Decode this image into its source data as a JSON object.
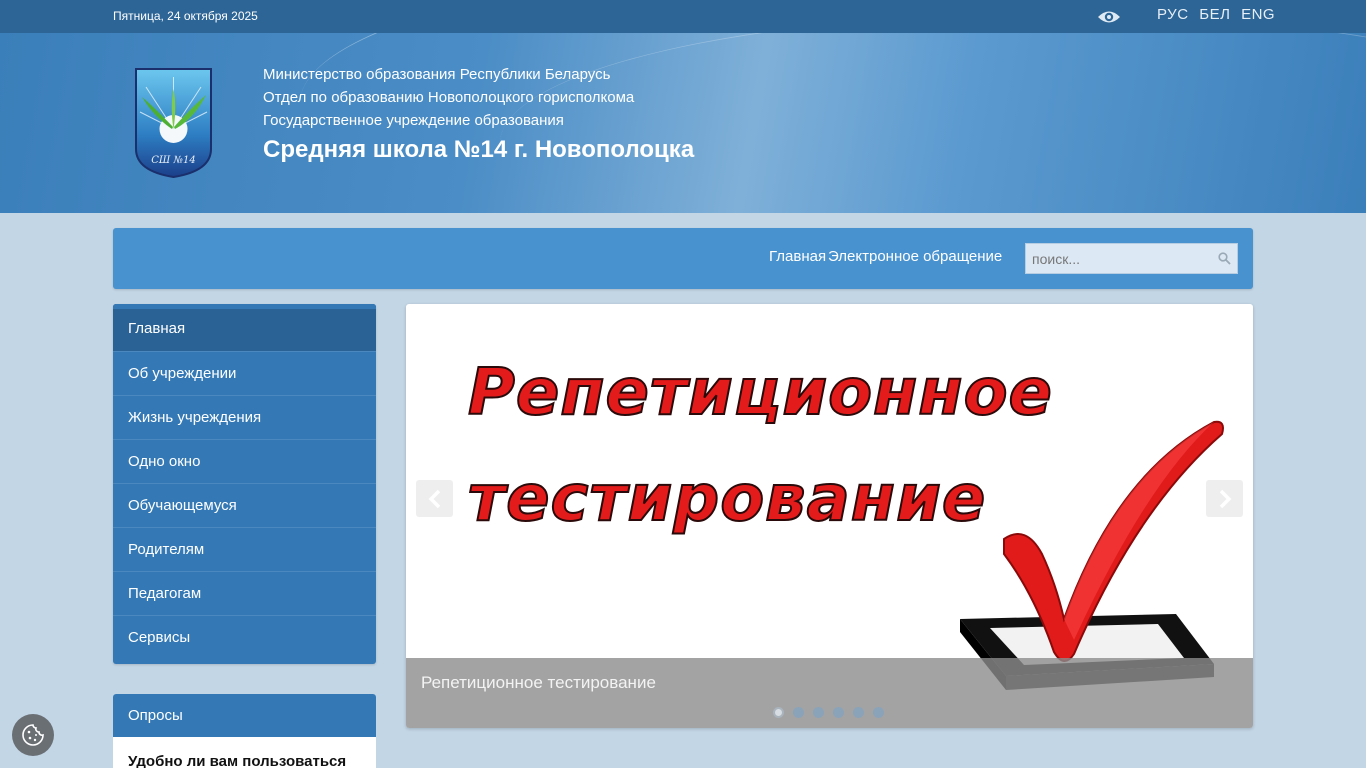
{
  "topbar": {
    "date": "Пятница, 24 октября 2025",
    "visually_impaired_icon": "eye-icon",
    "languages": [
      "РУС",
      "БЕЛ",
      "ENG"
    ]
  },
  "header": {
    "line1": "Министерство образования Республики Беларусь",
    "line2": "Отдел по образованию Новополоцкого горисполкома",
    "line3": "Государственное учреждение образования",
    "school_name": "Средняя школа №14 г. Новополоцка",
    "crest_text": "СШ №14"
  },
  "nav": {
    "links": [
      "Главная",
      "Электронное обращение"
    ],
    "search_placeholder": "поиск...",
    "search_icon": "search-icon"
  },
  "sidebar": {
    "items": [
      {
        "label": "Главная",
        "active": true
      },
      {
        "label": "Об учреждении"
      },
      {
        "label": "Жизнь учреждения"
      },
      {
        "label": "Одно окно"
      },
      {
        "label": "Обучающемуся"
      },
      {
        "label": "Родителям"
      },
      {
        "label": "Педагогам"
      },
      {
        "label": "Сервисы"
      }
    ]
  },
  "polls": {
    "title": "Опросы",
    "question": "Удобно ли вам пользоваться"
  },
  "slider": {
    "image_line1": "Репетиционное",
    "image_line2": "тестирование",
    "caption": "Репетиционное тестирование",
    "slide_count": 6,
    "active_slide": 1,
    "prev_icon": "chevron-left-icon",
    "next_icon": "chevron-right-icon"
  },
  "colors": {
    "topbar": "#2c6596",
    "nav": "#4892cf",
    "sidebar": "#3479b5",
    "sidebar_active": "#2a6296",
    "headline_red": "#e31b1b"
  },
  "cookie_icon": "cookie-icon"
}
